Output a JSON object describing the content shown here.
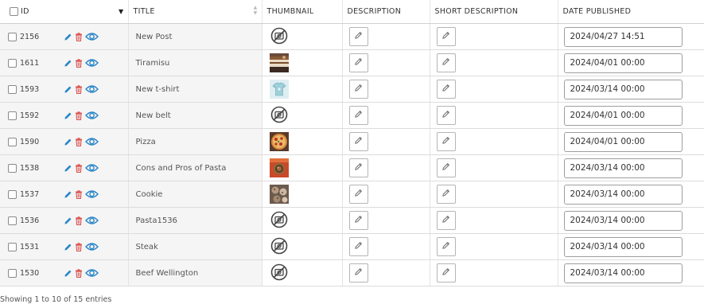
{
  "header": {
    "id": "ID",
    "title": "TITLE",
    "thumbnail": "THUMBNAIL",
    "description": "DESCRIPTION",
    "short_description": "SHORT DESCRIPTION",
    "date_published": "DATE PUBLISHED"
  },
  "rows": [
    {
      "id": "2156",
      "title": "New Post",
      "thumb": "none",
      "date": "2024/04/27 14:51"
    },
    {
      "id": "1611",
      "title": "Tiramisu",
      "thumb": "tiramisu",
      "date": "2024/04/01 00:00"
    },
    {
      "id": "1593",
      "title": "New t-shirt",
      "thumb": "tshirt",
      "date": "2024/03/14 00:00"
    },
    {
      "id": "1592",
      "title": "New belt",
      "thumb": "none",
      "date": "2024/04/01 00:00"
    },
    {
      "id": "1590",
      "title": "Pizza",
      "thumb": "pizza",
      "date": "2024/04/01 00:00"
    },
    {
      "id": "1538",
      "title": "Cons and Pros of Pasta",
      "thumb": "pasta",
      "date": "2024/03/14 00:00"
    },
    {
      "id": "1537",
      "title": "Cookie",
      "thumb": "cookie",
      "date": "2024/03/14 00:00"
    },
    {
      "id": "1536",
      "title": "Pasta1536",
      "thumb": "none",
      "date": "2024/03/14 00:00"
    },
    {
      "id": "1531",
      "title": "Steak",
      "thumb": "none",
      "date": "2024/03/14 00:00"
    },
    {
      "id": "1530",
      "title": "Beef Wellington",
      "thumb": "none",
      "date": "2024/03/14 00:00"
    }
  ],
  "footer": {
    "info": "Showing 1 to 10 of 15 entries"
  },
  "colors": {
    "action_blue": "#2a86c8",
    "trash_red": "#d9534f"
  }
}
